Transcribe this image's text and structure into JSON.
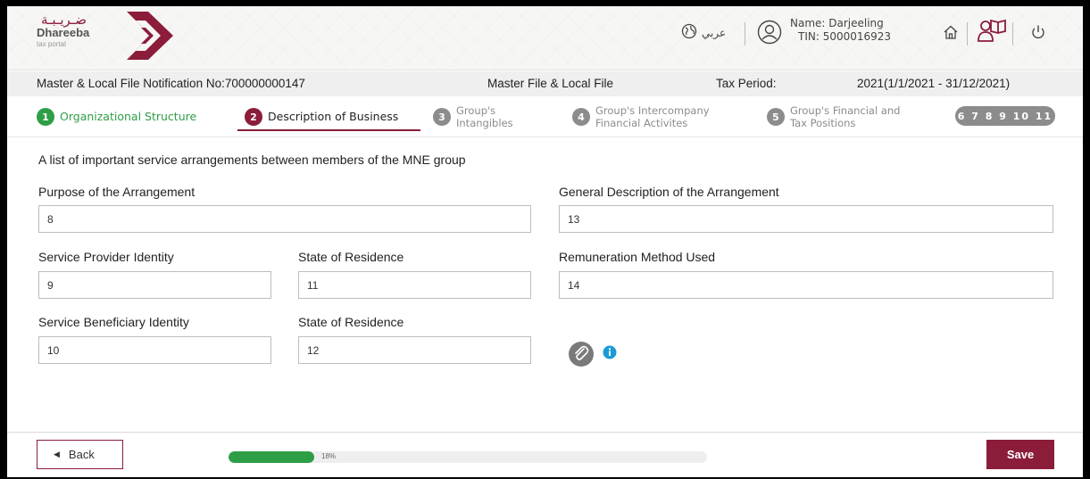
{
  "header": {
    "logo_ar": "ضـريـبـة",
    "logo_en": "Dhareeba",
    "logo_sub": "tax portal",
    "lang_label": "عربي",
    "user_name": "Name: Darjeeling",
    "user_tin": "TIN: 5000016923",
    "icons": [
      "globe-icon",
      "user-icon",
      "home-icon",
      "user-guide-icon",
      "power-icon"
    ]
  },
  "infobar": {
    "notification": "Master & Local File Notification No:700000000147",
    "file_type": "Master File & Local File",
    "tax_period_label": "Tax Period:",
    "tax_period_value": "2021(1/1/2021 - 31/12/2021)"
  },
  "steps": [
    {
      "num": "1",
      "label": "Organizational Structure",
      "state": "completed"
    },
    {
      "num": "2",
      "label": "Description of Business",
      "state": "active"
    },
    {
      "num": "3",
      "label_l1": "Group's",
      "label_l2": "Intangibles",
      "state": "pending"
    },
    {
      "num": "4",
      "label_l1": "Group's Intercompany",
      "label_l2": "Financial Activites",
      "state": "pending"
    },
    {
      "num": "5",
      "label_l1": "Group's Financial and",
      "label_l2": "Tax Positions",
      "state": "pending"
    }
  ],
  "more_steps": "6 7 8 9 10 11",
  "form": {
    "section_title": "A list of important service arrangements between members of the MNE group",
    "purpose": {
      "label": "Purpose of the Arrangement",
      "value": "8"
    },
    "general_description": {
      "label": "General Description of the Arrangement",
      "value": "13"
    },
    "provider_identity": {
      "label": "Service Provider Identity",
      "value": "9"
    },
    "provider_residence": {
      "label": "State of Residence",
      "value": "11"
    },
    "remuneration": {
      "label": "Remuneration Method Used",
      "value": "14"
    },
    "beneficiary_identity": {
      "label": "Service Beneficiary Identity",
      "value": "10"
    },
    "beneficiary_residence": {
      "label": "State of Residence",
      "value": "12"
    }
  },
  "footer": {
    "back_label": "Back",
    "save_label": "Save",
    "progress_percent": 18,
    "progress_text": "18%"
  },
  "colors": {
    "brand": "#8b1c3a",
    "success": "#2e9e46",
    "pending": "#8c8c8c",
    "info": "#1a9ad6"
  }
}
